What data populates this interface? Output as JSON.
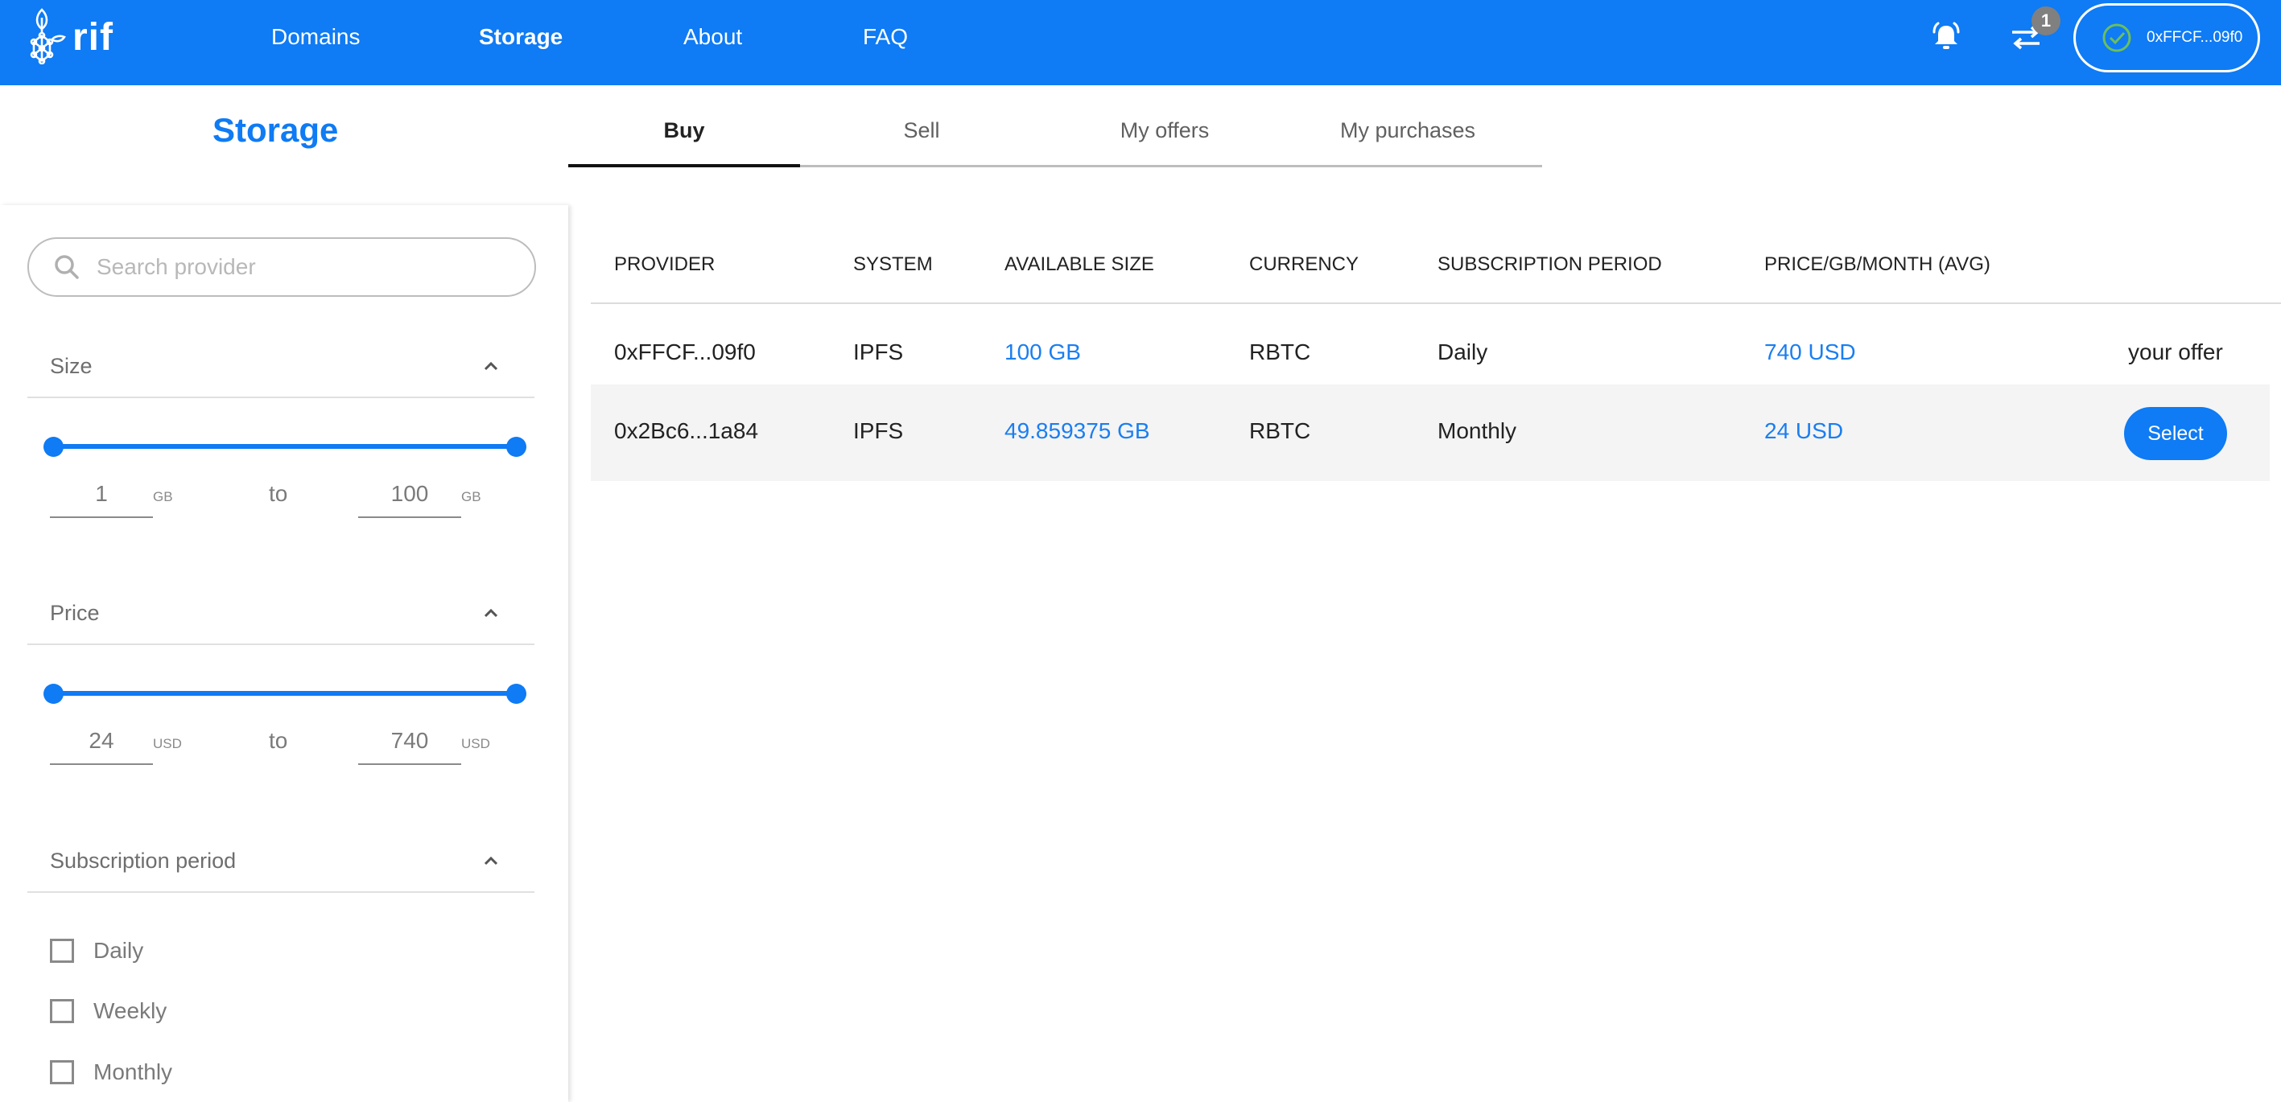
{
  "header": {
    "logo_text": "rif",
    "nav": [
      {
        "label": "Domains",
        "active": false
      },
      {
        "label": "Storage",
        "active": true
      },
      {
        "label": "About",
        "active": false
      },
      {
        "label": "FAQ",
        "active": false
      }
    ],
    "notifications_icon": "bell-icon",
    "transactions_icon": "swap-arrows-icon",
    "transactions_badge": "1",
    "wallet": {
      "status_icon": "check-circle-icon",
      "address": "0xFFCF...09f0",
      "status_color": "#6abf5e"
    }
  },
  "page": {
    "title": "Storage",
    "tabs": [
      {
        "label": "Buy",
        "active": true
      },
      {
        "label": "Sell",
        "active": false
      },
      {
        "label": "My offers",
        "active": false
      },
      {
        "label": "My purchases",
        "active": false
      }
    ]
  },
  "filters": {
    "search": {
      "placeholder": "Search provider",
      "value": ""
    },
    "size": {
      "title": "Size",
      "min": "1",
      "max": "100",
      "unit": "GB",
      "to_label": "to",
      "slider_low_fraction": 0,
      "slider_high_fraction": 1
    },
    "price": {
      "title": "Price",
      "min": "24",
      "max": "740",
      "unit": "USD",
      "to_label": "to",
      "slider_low_fraction": 0,
      "slider_high_fraction": 1
    },
    "subscription": {
      "title": "Subscription period",
      "options": [
        {
          "label": "Daily",
          "checked": false
        },
        {
          "label": "Weekly",
          "checked": false
        },
        {
          "label": "Monthly",
          "checked": false
        }
      ]
    }
  },
  "table": {
    "columns": [
      "PROVIDER",
      "SYSTEM",
      "AVAILABLE SIZE",
      "CURRENCY",
      "SUBSCRIPTION PERIOD",
      "PRICE/GB/MONTH (AVG)"
    ],
    "rows": [
      {
        "provider": "0xFFCF...09f0",
        "system": "IPFS",
        "available_size": "100 GB",
        "currency": "RBTC",
        "period": "Daily",
        "price": "740 USD",
        "action": "your offer"
      },
      {
        "provider": "0x2Bc6...1a84",
        "system": "IPFS",
        "available_size": "49.859375 GB",
        "currency": "RBTC",
        "period": "Monthly",
        "price": "24 USD",
        "action": "Select"
      }
    ]
  },
  "colors": {
    "brand": "#0f7bf4",
    "link": "#1a7ef0",
    "row_alt": "#f4f4f4"
  }
}
